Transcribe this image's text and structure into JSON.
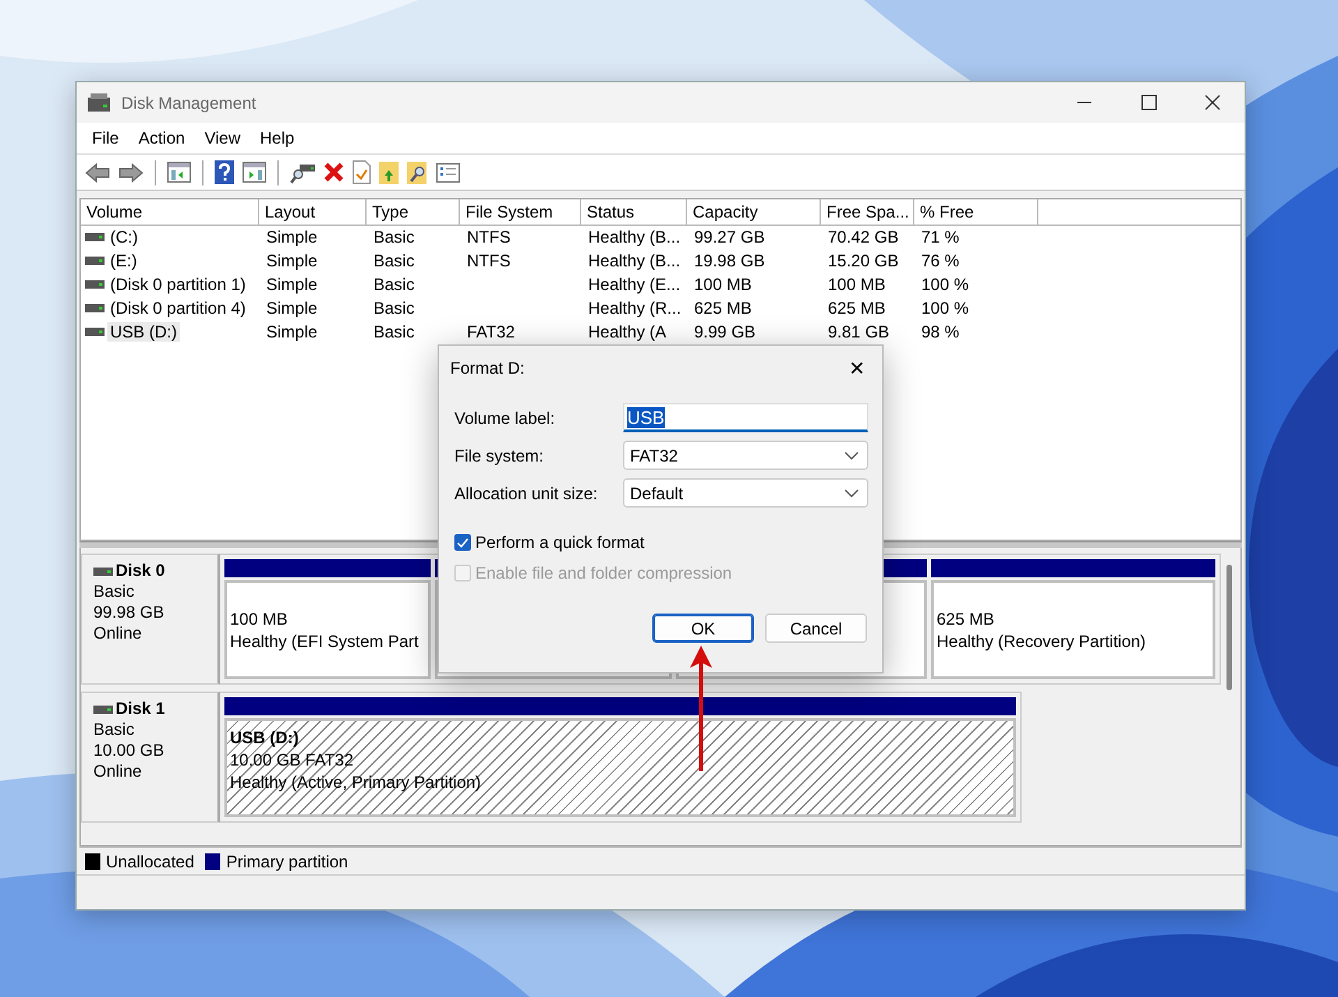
{
  "window": {
    "title": "Disk Management"
  },
  "menu": [
    {
      "label": "File"
    },
    {
      "label": "Action"
    },
    {
      "label": "View"
    },
    {
      "label": "Help"
    }
  ],
  "volumes": {
    "columns": [
      "Volume",
      "Layout",
      "Type",
      "File System",
      "Status",
      "Capacity",
      "Free Spa...",
      "% Free"
    ],
    "rows": [
      {
        "selected": false,
        "cells": [
          "(C:)",
          "Simple",
          "Basic",
          "NTFS",
          "Healthy (B...",
          "99.27 GB",
          "70.42 GB",
          "71 %"
        ]
      },
      {
        "selected": false,
        "cells": [
          "(E:)",
          "Simple",
          "Basic",
          "NTFS",
          "Healthy (B...",
          "19.98 GB",
          "15.20 GB",
          "76 %"
        ]
      },
      {
        "selected": false,
        "cells": [
          "(Disk 0 partition 1)",
          "Simple",
          "Basic",
          "",
          "Healthy (E...",
          "100 MB",
          "100 MB",
          "100 %"
        ]
      },
      {
        "selected": false,
        "cells": [
          "(Disk 0 partition 4)",
          "Simple",
          "Basic",
          "",
          "Healthy (R...",
          "625 MB",
          "625 MB",
          "100 %"
        ]
      },
      {
        "selected": true,
        "cells": [
          "USB (D:)",
          "Simple",
          "Basic",
          "FAT32",
          "Healthy (A",
          "9.99 GB",
          "9.81 GB",
          "98 %"
        ]
      }
    ]
  },
  "disks": [
    {
      "name": "Disk 0",
      "lines": [
        "Basic",
        "99.98 GB",
        "Online"
      ],
      "partitions": [
        {
          "kind": "primary",
          "selected": false,
          "lines": [
            "100 MB",
            "Healthy (EFI System Part"
          ]
        },
        {
          "kind": "primary",
          "selected": false
        },
        {
          "kind": "primary",
          "selected": false
        },
        {
          "kind": "primary",
          "selected": false,
          "lines": [
            "625 MB",
            "Healthy (Recovery Partition)"
          ]
        }
      ]
    },
    {
      "name": "Disk 1",
      "lines": [
        "Basic",
        "10.00 GB",
        "Online"
      ],
      "partitions": [
        {
          "kind": "primary",
          "selected": true,
          "name": "USB  (D:)",
          "lines": [
            "10.00 GB FAT32",
            "Healthy (Active, Primary Partition)"
          ]
        }
      ]
    }
  ],
  "legend": [
    {
      "label": "Unallocated",
      "color": "#000000"
    },
    {
      "label": "Primary partition",
      "color": "#000080"
    }
  ],
  "dialog": {
    "title": "Format D:",
    "close": "✕",
    "fields": [
      {
        "kind": "text",
        "label": "Volume label:",
        "value": "USB",
        "selected": true
      },
      {
        "kind": "dropdown",
        "label": "File system:",
        "value": "FAT32"
      },
      {
        "kind": "dropdown",
        "label": "Allocation unit size:",
        "value": "Default"
      }
    ],
    "options": [
      {
        "label": "Perform a quick format",
        "checked": true,
        "disabled": false
      },
      {
        "label": "Enable file and folder compression",
        "checked": false,
        "disabled": true
      }
    ],
    "buttons": [
      {
        "label": "OK",
        "default": true
      },
      {
        "label": "Cancel",
        "default": false
      }
    ]
  }
}
